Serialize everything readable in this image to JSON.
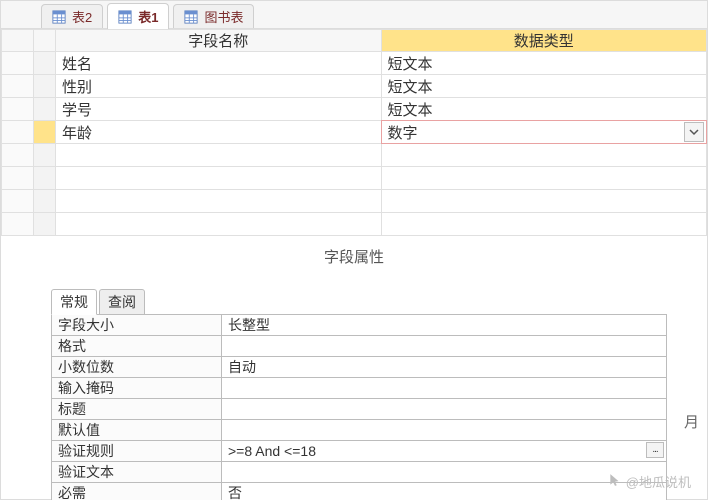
{
  "tabs": [
    {
      "label": "表2",
      "active": false
    },
    {
      "label": "表1",
      "active": true
    },
    {
      "label": "图书表",
      "active": false
    }
  ],
  "grid": {
    "headers": {
      "name": "字段名称",
      "type": "数据类型"
    },
    "rows": [
      {
        "name": "姓名",
        "type": "短文本",
        "active": false,
        "dropdown": false
      },
      {
        "name": "性别",
        "type": "短文本",
        "active": false,
        "dropdown": false
      },
      {
        "name": "学号",
        "type": "短文本",
        "active": false,
        "dropdown": false
      },
      {
        "name": "年龄",
        "type": "数字",
        "active": true,
        "dropdown": true
      }
    ],
    "empty_rows": 4
  },
  "props_section_label": "字段属性",
  "prop_tabs": [
    {
      "label": "常规",
      "active": true
    },
    {
      "label": "查阅",
      "active": false
    }
  ],
  "props": [
    {
      "label": "字段大小",
      "value": "长整型"
    },
    {
      "label": "格式",
      "value": ""
    },
    {
      "label": "小数位数",
      "value": "自动"
    },
    {
      "label": "输入掩码",
      "value": ""
    },
    {
      "label": "标题",
      "value": ""
    },
    {
      "label": "默认值",
      "value": ""
    },
    {
      "label": "验证规则",
      "value": ">=8 And <=18",
      "builder": true
    },
    {
      "label": "验证文本",
      "value": ""
    },
    {
      "label": "必需",
      "value": "否"
    }
  ],
  "side_char": "月",
  "watermark": "@地瓜说机"
}
